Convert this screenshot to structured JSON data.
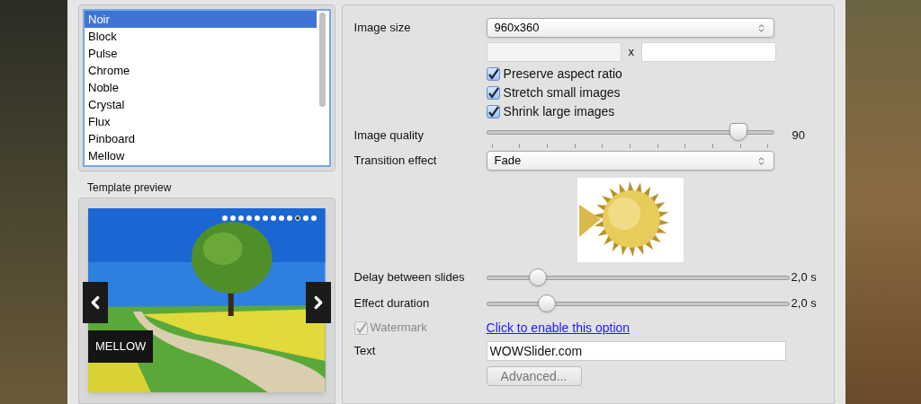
{
  "templates": {
    "items": [
      {
        "label": "Noir",
        "selected": true
      },
      {
        "label": "Block",
        "selected": false
      },
      {
        "label": "Pulse",
        "selected": false
      },
      {
        "label": "Chrome",
        "selected": false
      },
      {
        "label": "Noble",
        "selected": false
      },
      {
        "label": "Crystal",
        "selected": false
      },
      {
        "label": "Flux",
        "selected": false
      },
      {
        "label": "Pinboard",
        "selected": false
      },
      {
        "label": "Mellow",
        "selected": false
      }
    ]
  },
  "preview": {
    "title": "Template preview",
    "caption": "MELLOW",
    "dots": [
      {
        "selected": false
      },
      {
        "selected": false
      },
      {
        "selected": false
      },
      {
        "selected": false
      },
      {
        "selected": false
      },
      {
        "selected": false
      },
      {
        "selected": false
      },
      {
        "selected": false
      },
      {
        "selected": false
      },
      {
        "selected": true
      },
      {
        "selected": false
      },
      {
        "selected": false
      }
    ]
  },
  "parameters": {
    "image_size": {
      "label": "Image size",
      "value": "960x360",
      "separator": "x"
    },
    "checkboxes": [
      {
        "label": "Preserve aspect ratio",
        "checked": true
      },
      {
        "label": "Stretch small images",
        "checked": true
      },
      {
        "label": "Shrink large images",
        "checked": true
      }
    ],
    "image_quality": {
      "label": "Image quality",
      "level": 0.875,
      "reading": "90"
    },
    "transition": {
      "label": "Transition effect",
      "value": "Fade"
    },
    "delay": {
      "label": "Delay between slides",
      "level": 0.17,
      "reading": "2,0 s"
    },
    "effect_duration": {
      "label": "Effect duration",
      "level": 0.2,
      "reading": "2,0 s"
    },
    "watermark": {
      "label": "Watermark",
      "checked": true,
      "disabled": true,
      "link": "Click to enable this option"
    },
    "text": {
      "label": "Text",
      "value": "WOWSlider.com"
    },
    "advanced_button": {
      "label": "Advanced...",
      "disabled": true
    }
  }
}
